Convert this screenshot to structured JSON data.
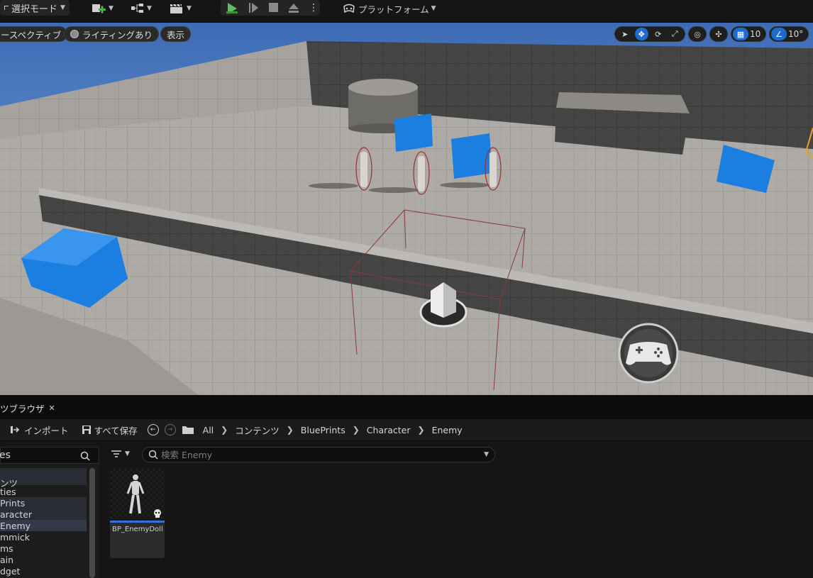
{
  "toolbar": {
    "mode_label": "選択モード",
    "platform_label": "プラットフォーム"
  },
  "viewport": {
    "perspective_label": "ースペクティブ",
    "lighting_label": "ライティングあり",
    "show_label": "表示",
    "grid_snap_value": "10",
    "rotation_snap_value": "10°"
  },
  "content_browser": {
    "tab_label": "ツブラウザ",
    "import_label": "インポート",
    "save_all_label": "すべて保存",
    "breadcrumbs": [
      "All",
      "コンテンツ",
      "BluePrints",
      "Character",
      "Enemy"
    ],
    "sources_search_label": "es",
    "search_placeholder": "検索 Enemy",
    "tree": [
      {
        "label": "ンツ"
      },
      {
        "label": "ties"
      },
      {
        "label": "Prints"
      },
      {
        "label": "aracter"
      },
      {
        "label": "Enemy"
      },
      {
        "label": "mmick"
      },
      {
        "label": "ms"
      },
      {
        "label": "ain"
      },
      {
        "label": "dget"
      }
    ],
    "asset": {
      "name": "BP_EnemyDoll"
    }
  },
  "colors": {
    "accent": "#1f6cd1",
    "cube": "#1a7fe0",
    "sky": "#3d6cb5"
  }
}
